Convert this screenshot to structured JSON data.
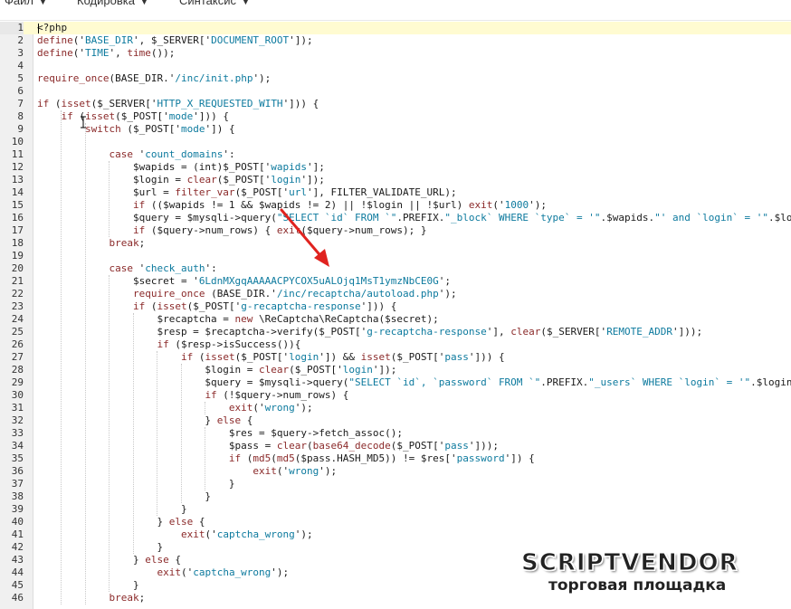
{
  "menu": [
    {
      "label": "Файл"
    },
    {
      "label": "Кодировка"
    },
    {
      "label": "Синтаксис"
    }
  ],
  "accent_colors": {
    "keyword": "#8b2a2a",
    "string": "#0d7a9e",
    "arrow": "#e0231f",
    "active_line": "#fffbd1"
  },
  "code_lines": [
    {
      "n": "1",
      "t": "<?php"
    },
    {
      "n": "2",
      "t": "define('BASE_DIR', $_SERVER['DOCUMENT_ROOT']);"
    },
    {
      "n": "3",
      "t": "define('TIME', time());"
    },
    {
      "n": "4",
      "t": ""
    },
    {
      "n": "5",
      "t": "require_once(BASE_DIR.'/inc/init.php');"
    },
    {
      "n": "6",
      "t": ""
    },
    {
      "n": "7",
      "t": "if (isset($_SERVER['HTTP_X_REQUESTED_WITH'])) {"
    },
    {
      "n": "8",
      "t": "    if (isset($_POST['mode'])) {"
    },
    {
      "n": "9",
      "t": "        switch ($_POST['mode']) {"
    },
    {
      "n": "10",
      "t": ""
    },
    {
      "n": "11",
      "t": "            case 'count_domains':"
    },
    {
      "n": "12",
      "t": "                $wapids = (int)$_POST['wapids'];"
    },
    {
      "n": "13",
      "t": "                $login = clear($_POST['login']);"
    },
    {
      "n": "14",
      "t": "                $url = filter_var($_POST['url'], FILTER_VALIDATE_URL);"
    },
    {
      "n": "15",
      "t": "                if (($wapids != 1 && $wapids != 2) || !$login || !$url) exit('1000');"
    },
    {
      "n": "16",
      "t": "                $query = $mysqli->query(\"SELECT `id` FROM `\".PREFIX.\"_block` WHERE `type` = '\".$wapids.\"' and `login` = '\".$login"
    },
    {
      "n": "17",
      "t": "                if ($query->num_rows) { exit($query->num_rows); }"
    },
    {
      "n": "18",
      "t": "            break;"
    },
    {
      "n": "19",
      "t": ""
    },
    {
      "n": "20",
      "t": "            case 'check_auth':"
    },
    {
      "n": "21",
      "t": "                $secret = '6LdnMXgqAAAAACPYCOX5uALOjq1MsT1ymzNbCE0G';"
    },
    {
      "n": "22",
      "t": "                require_once (BASE_DIR.'/inc/recaptcha/autoload.php');"
    },
    {
      "n": "23",
      "t": "                if (isset($_POST['g-recaptcha-response'])) {"
    },
    {
      "n": "24",
      "t": "                    $recaptcha = new \\ReCaptcha\\ReCaptcha($secret);"
    },
    {
      "n": "25",
      "t": "                    $resp = $recaptcha->verify($_POST['g-recaptcha-response'], clear($_SERVER['REMOTE_ADDR']));"
    },
    {
      "n": "26",
      "t": "                    if ($resp->isSuccess()){"
    },
    {
      "n": "27",
      "t": "                        if (isset($_POST['login']) && isset($_POST['pass'])) {"
    },
    {
      "n": "28",
      "t": "                            $login = clear($_POST['login']);"
    },
    {
      "n": "29",
      "t": "                            $query = $mysqli->query(\"SELECT `id`, `password` FROM `\".PREFIX.\"_users` WHERE `login` = '\".$login"
    },
    {
      "n": "30",
      "t": "                            if (!$query->num_rows) {"
    },
    {
      "n": "31",
      "t": "                                exit('wrong');"
    },
    {
      "n": "32",
      "t": "                            } else {"
    },
    {
      "n": "33",
      "t": "                                $res = $query->fetch_assoc();"
    },
    {
      "n": "34",
      "t": "                                $pass = clear(base64_decode($_POST['pass']));"
    },
    {
      "n": "35",
      "t": "                                if (md5(md5($pass.HASH_MD5)) != $res['password']) {"
    },
    {
      "n": "36",
      "t": "                                    exit('wrong');"
    },
    {
      "n": "37",
      "t": "                                }"
    },
    {
      "n": "38",
      "t": "                            }"
    },
    {
      "n": "39",
      "t": "                        }"
    },
    {
      "n": "40",
      "t": "                    } else {"
    },
    {
      "n": "41",
      "t": "                        exit('captcha_wrong');"
    },
    {
      "n": "42",
      "t": "                    }"
    },
    {
      "n": "43",
      "t": "                } else {"
    },
    {
      "n": "44",
      "t": "                    exit('captcha_wrong');"
    },
    {
      "n": "45",
      "t": "                }"
    },
    {
      "n": "46",
      "t": "            break;"
    }
  ],
  "watermark": {
    "title": "SCRIPTVENDOR",
    "subtitle": "торговая площадка"
  }
}
